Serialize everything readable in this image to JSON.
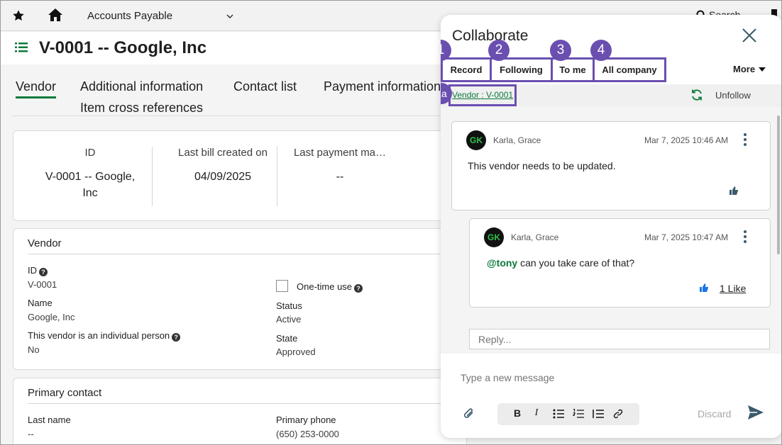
{
  "topbar": {
    "app_name": "Accounts Payable",
    "search_label": "Search",
    "icons": [
      "star-icon",
      "home-icon",
      "chevron-down-icon",
      "search-icon"
    ]
  },
  "page": {
    "title": "V-0001 -- Google, Inc",
    "tabs": [
      {
        "label": "Vendor",
        "active": true
      },
      {
        "label": "Additional information"
      },
      {
        "label": "Contact list"
      },
      {
        "label": "Payment information"
      },
      {
        "label": "Item cross references"
      }
    ]
  },
  "summary": {
    "id_label": "ID",
    "id_value_line1": "V-0001 -- Google,",
    "id_value_line2": "Inc",
    "last_bill_label": "Last bill created on",
    "last_bill_value": "04/09/2025",
    "last_payment_label": "Last payment ma…",
    "last_payment_value": "--"
  },
  "vendor_section": {
    "title": "Vendor",
    "id_label": "ID",
    "id_value": "V-0001",
    "name_label": "Name",
    "name_value": "Google, Inc",
    "individual_label": "This vendor is an individual person",
    "individual_value": "No",
    "one_time_label": "One-time use",
    "status_label": "Status",
    "status_value": "Active",
    "state_label": "State",
    "state_value": "Approved"
  },
  "primary_contact": {
    "title": "Primary contact",
    "last_name_label": "Last name",
    "last_name_value": "--",
    "phone_label": "Primary phone",
    "phone_value": "(650) 253-0000"
  },
  "collaborate": {
    "title": "Collaborate",
    "filter_tabs": [
      {
        "label": "Record",
        "badge": "1"
      },
      {
        "label": "Following",
        "badge": "2"
      },
      {
        "label": "To me",
        "badge": "3"
      },
      {
        "label": "All company",
        "badge": "4"
      }
    ],
    "more_label": "More",
    "record_link": "Vendor : V-0001",
    "record_link_badge": "1a",
    "unfollow_label": "Unfollow",
    "comments": [
      {
        "initials": "GK",
        "author": "Karla, Grace",
        "timestamp": "Mar 7, 2025 10:46 AM",
        "text": "This vendor needs to be updated."
      },
      {
        "initials": "GK",
        "author": "Karla, Grace",
        "timestamp": "Mar 7, 2025 10:47 AM",
        "mention": "@tony",
        "text": "can you take care of that?",
        "likes": "1 Like"
      }
    ],
    "reply_placeholder": "Reply...",
    "message_placeholder": "Type a new message",
    "format_buttons": [
      "B",
      "I"
    ],
    "discard_label": "Discard",
    "colors": {
      "accent": "#6a4fb0",
      "link": "#0a7a3b",
      "avatar_text": "#2ec24a",
      "like": "#1a73e8",
      "thumb": "#3c5a6a"
    }
  }
}
